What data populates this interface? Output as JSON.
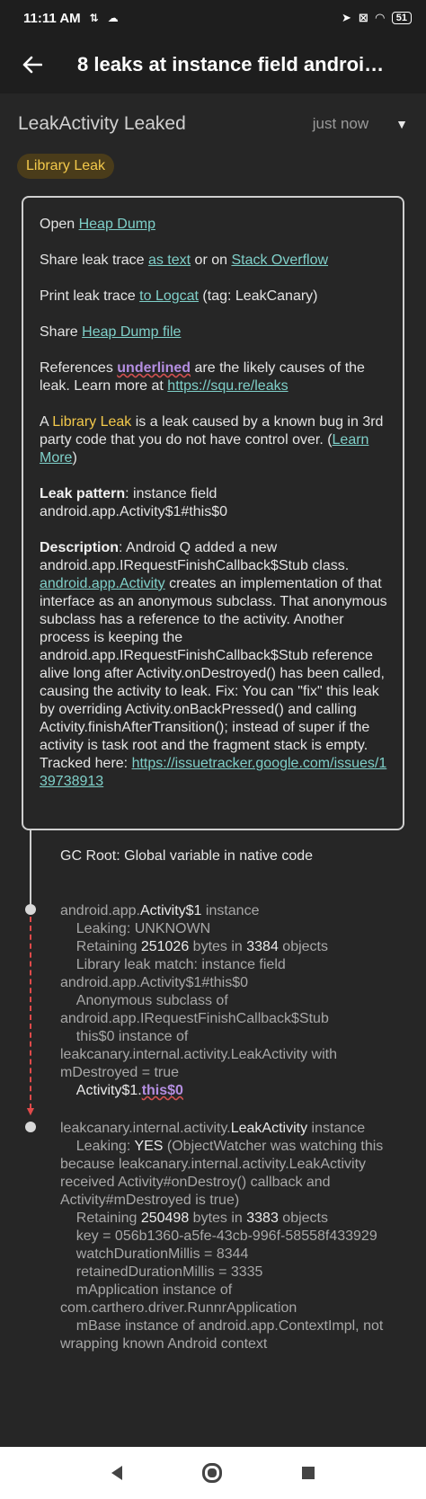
{
  "status_bar": {
    "time": "11:11 AM",
    "battery": "51"
  },
  "toolbar": {
    "title": "8 leaks at instance field androi…"
  },
  "header": {
    "title": "LeakActivity Leaked",
    "time": "just now"
  },
  "badge": "Library Leak",
  "card": {
    "open_prefix": "Open ",
    "open_link": "Heap Dump",
    "share_prefix": "Share leak trace ",
    "share_text_link": "as text",
    "share_or": " or on ",
    "share_so_link": "Stack Overflow",
    "print_prefix": "Print leak trace ",
    "print_link": "to Logcat",
    "print_suffix": " (tag: LeakCanary)",
    "sharefile_prefix": "Share ",
    "sharefile_link": "Heap Dump file",
    "refs_prefix": "References ",
    "refs_underlined": "underlined",
    "refs_suffix": " are the likely causes of the leak. Learn more at ",
    "refs_link": "https://squ.re/leaks",
    "lib_prefix": "A ",
    "lib_word": "Library Leak",
    "lib_suffix": " is a leak caused by a known bug in 3rd party code that you do not have control over. (",
    "lib_link": "Learn More",
    "lib_close": ")",
    "pattern_label": "Leak pattern",
    "pattern_value": ": instance field android.app.Activity$1#this$0",
    "desc_label": "Description",
    "desc_part1": ": Android Q added a new android.app.IRequestFinishCallback$Stub class. ",
    "desc_link": "android.app.Activity",
    "desc_part2": " creates an implementation of that interface as an anonymous subclass. That anonymous subclass has a reference to the activity. Another process is keeping the android.app.IRequestFinishCallback$Stub reference alive long after Activity.onDestroyed() has been called, causing the activity to leak. Fix: You can \"fix\" this leak by overriding Activity.onBackPressed() and calling Activity.finishAfterTransition(); instead of super if the activity is task root and the fragment stack is empty. Tracked here: ",
    "desc_tracker_link": "https://issuetracker.google.com/issues/139738913"
  },
  "trace": {
    "gc_root": "GC Root: Global variable in native code",
    "node1": {
      "pkg": "android.app.",
      "cls": "Activity$1",
      "suffix": " instance",
      "leaking": "    Leaking: UNKNOWN",
      "ret_prefix": "    Retaining ",
      "ret_bytes": "251026",
      "ret_mid": " bytes in ",
      "ret_objs": "3384",
      "ret_suffix": " objects",
      "details": "    Library leak match: instance field android.app.Activity$1#this$0\n    Anonymous subclass of android.app.IRequestFinishCallback$Stub\n    this$0 instance of leakcanary.internal.activity.LeakActivity with mDestroyed = true",
      "ref_cls": "    Activity$1.",
      "ref_field": "this$0"
    },
    "node2": {
      "pkg": "leakcanary.internal.activity.",
      "cls": "LeakActivity",
      "suffix": " instance",
      "leaking_prefix": "    Leaking: ",
      "leaking_value": "YES",
      "leaking_suffix": " (ObjectWatcher was watching this because leakcanary.internal.activity.LeakActivity received Activity#onDestroy() callback and Activity#mDestroyed is true)",
      "ret_prefix": "    Retaining ",
      "ret_bytes": "250498",
      "ret_mid": " bytes in ",
      "ret_objs": "3383",
      "ret_suffix": " objects",
      "details": "    key = 056b1360-a5fe-43cb-996f-58558f433929\n    watchDurationMillis = 8344\n    retainedDurationMillis = 3335\n    mApplication instance of com.carthero.driver.RunnrApplication\n    mBase instance of android.app.ContextImpl, not wrapping known Android context"
    }
  }
}
